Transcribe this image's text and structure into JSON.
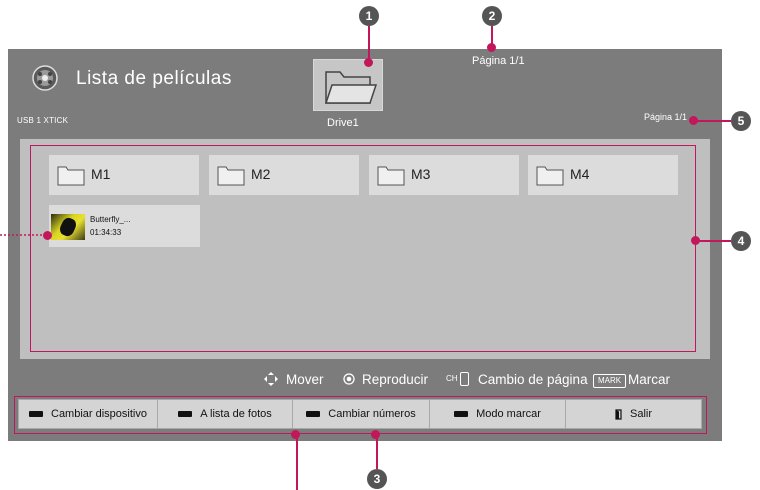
{
  "header": {
    "title": "Lista de películas",
    "device_label": "USB 1 XTICK",
    "drive_label": "Drive1",
    "page_top": "Página 1/1",
    "page_right": "Página 1/1"
  },
  "folders": [
    {
      "label": "M1"
    },
    {
      "label": "M2"
    },
    {
      "label": "M3"
    },
    {
      "label": "M4"
    }
  ],
  "files": [
    {
      "name": "Butterfly_...",
      "duration": "01:34:33"
    }
  ],
  "hints": {
    "move": "Mover",
    "play": "Reproducir",
    "ch_tag": "CH",
    "page_change": "Cambio de página",
    "mark_tag": "MARK",
    "mark": "Marcar"
  },
  "buttons": [
    {
      "label": "Cambiar dispositivo",
      "icon": "black-key"
    },
    {
      "label": "A lista de fotos",
      "icon": "black-key"
    },
    {
      "label": "Cambiar números",
      "icon": "black-key"
    },
    {
      "label": "Modo marcar",
      "icon": "black-key"
    },
    {
      "label": "Salir",
      "icon": "exit-key"
    }
  ],
  "callouts": [
    "1",
    "2",
    "3",
    "4",
    "5"
  ],
  "colors": {
    "screen": "#7c7c7c",
    "panel": "#bfbfbf",
    "tile": "#dcdcdc",
    "callout_line": "#c2185b",
    "callout_badge": "#555555"
  }
}
